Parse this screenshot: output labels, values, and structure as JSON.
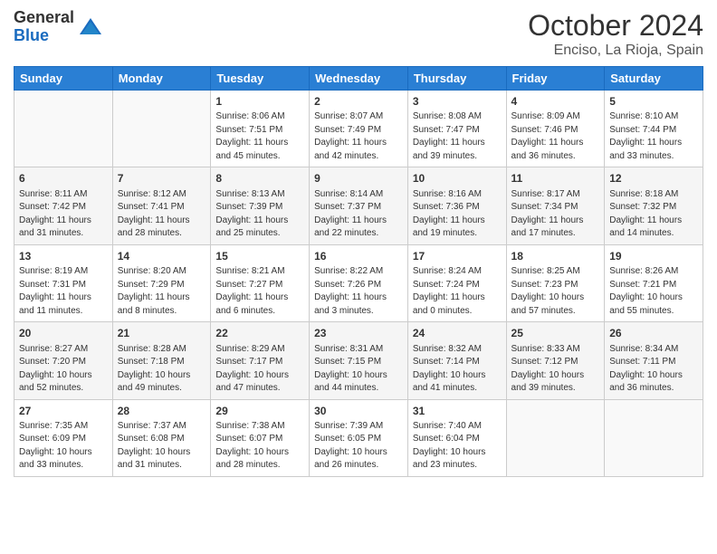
{
  "logo": {
    "general": "General",
    "blue": "Blue"
  },
  "header": {
    "month": "October 2024",
    "location": "Enciso, La Rioja, Spain"
  },
  "weekdays": [
    "Sunday",
    "Monday",
    "Tuesday",
    "Wednesday",
    "Thursday",
    "Friday",
    "Saturday"
  ],
  "weeks": [
    [
      {
        "day": "",
        "info": ""
      },
      {
        "day": "",
        "info": ""
      },
      {
        "day": "1",
        "info": "Sunrise: 8:06 AM\nSunset: 7:51 PM\nDaylight: 11 hours and 45 minutes."
      },
      {
        "day": "2",
        "info": "Sunrise: 8:07 AM\nSunset: 7:49 PM\nDaylight: 11 hours and 42 minutes."
      },
      {
        "day": "3",
        "info": "Sunrise: 8:08 AM\nSunset: 7:47 PM\nDaylight: 11 hours and 39 minutes."
      },
      {
        "day": "4",
        "info": "Sunrise: 8:09 AM\nSunset: 7:46 PM\nDaylight: 11 hours and 36 minutes."
      },
      {
        "day": "5",
        "info": "Sunrise: 8:10 AM\nSunset: 7:44 PM\nDaylight: 11 hours and 33 minutes."
      }
    ],
    [
      {
        "day": "6",
        "info": "Sunrise: 8:11 AM\nSunset: 7:42 PM\nDaylight: 11 hours and 31 minutes."
      },
      {
        "day": "7",
        "info": "Sunrise: 8:12 AM\nSunset: 7:41 PM\nDaylight: 11 hours and 28 minutes."
      },
      {
        "day": "8",
        "info": "Sunrise: 8:13 AM\nSunset: 7:39 PM\nDaylight: 11 hours and 25 minutes."
      },
      {
        "day": "9",
        "info": "Sunrise: 8:14 AM\nSunset: 7:37 PM\nDaylight: 11 hours and 22 minutes."
      },
      {
        "day": "10",
        "info": "Sunrise: 8:16 AM\nSunset: 7:36 PM\nDaylight: 11 hours and 19 minutes."
      },
      {
        "day": "11",
        "info": "Sunrise: 8:17 AM\nSunset: 7:34 PM\nDaylight: 11 hours and 17 minutes."
      },
      {
        "day": "12",
        "info": "Sunrise: 8:18 AM\nSunset: 7:32 PM\nDaylight: 11 hours and 14 minutes."
      }
    ],
    [
      {
        "day": "13",
        "info": "Sunrise: 8:19 AM\nSunset: 7:31 PM\nDaylight: 11 hours and 11 minutes."
      },
      {
        "day": "14",
        "info": "Sunrise: 8:20 AM\nSunset: 7:29 PM\nDaylight: 11 hours and 8 minutes."
      },
      {
        "day": "15",
        "info": "Sunrise: 8:21 AM\nSunset: 7:27 PM\nDaylight: 11 hours and 6 minutes."
      },
      {
        "day": "16",
        "info": "Sunrise: 8:22 AM\nSunset: 7:26 PM\nDaylight: 11 hours and 3 minutes."
      },
      {
        "day": "17",
        "info": "Sunrise: 8:24 AM\nSunset: 7:24 PM\nDaylight: 11 hours and 0 minutes."
      },
      {
        "day": "18",
        "info": "Sunrise: 8:25 AM\nSunset: 7:23 PM\nDaylight: 10 hours and 57 minutes."
      },
      {
        "day": "19",
        "info": "Sunrise: 8:26 AM\nSunset: 7:21 PM\nDaylight: 10 hours and 55 minutes."
      }
    ],
    [
      {
        "day": "20",
        "info": "Sunrise: 8:27 AM\nSunset: 7:20 PM\nDaylight: 10 hours and 52 minutes."
      },
      {
        "day": "21",
        "info": "Sunrise: 8:28 AM\nSunset: 7:18 PM\nDaylight: 10 hours and 49 minutes."
      },
      {
        "day": "22",
        "info": "Sunrise: 8:29 AM\nSunset: 7:17 PM\nDaylight: 10 hours and 47 minutes."
      },
      {
        "day": "23",
        "info": "Sunrise: 8:31 AM\nSunset: 7:15 PM\nDaylight: 10 hours and 44 minutes."
      },
      {
        "day": "24",
        "info": "Sunrise: 8:32 AM\nSunset: 7:14 PM\nDaylight: 10 hours and 41 minutes."
      },
      {
        "day": "25",
        "info": "Sunrise: 8:33 AM\nSunset: 7:12 PM\nDaylight: 10 hours and 39 minutes."
      },
      {
        "day": "26",
        "info": "Sunrise: 8:34 AM\nSunset: 7:11 PM\nDaylight: 10 hours and 36 minutes."
      }
    ],
    [
      {
        "day": "27",
        "info": "Sunrise: 7:35 AM\nSunset: 6:09 PM\nDaylight: 10 hours and 33 minutes."
      },
      {
        "day": "28",
        "info": "Sunrise: 7:37 AM\nSunset: 6:08 PM\nDaylight: 10 hours and 31 minutes."
      },
      {
        "day": "29",
        "info": "Sunrise: 7:38 AM\nSunset: 6:07 PM\nDaylight: 10 hours and 28 minutes."
      },
      {
        "day": "30",
        "info": "Sunrise: 7:39 AM\nSunset: 6:05 PM\nDaylight: 10 hours and 26 minutes."
      },
      {
        "day": "31",
        "info": "Sunrise: 7:40 AM\nSunset: 6:04 PM\nDaylight: 10 hours and 23 minutes."
      },
      {
        "day": "",
        "info": ""
      },
      {
        "day": "",
        "info": ""
      }
    ]
  ]
}
